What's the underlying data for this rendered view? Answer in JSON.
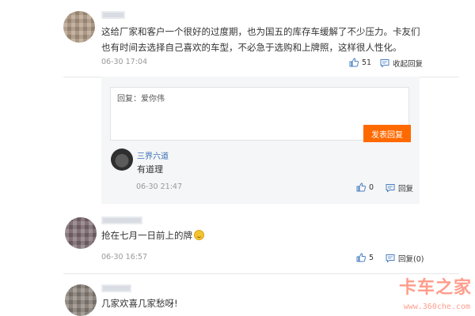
{
  "comments": [
    {
      "text": "这给厂家和客户一个很好的过度期，也为国五的库存车缓解了不少压力。卡友们也有时间去选择自己喜欢的车型，不必急于选购和上牌照，这样很人性化。",
      "time": "06-30 17:04",
      "likes": "51",
      "reply_label": "收起回复"
    },
    {
      "text": "抢在七月一日前上的牌",
      "time": "06-30 16:57",
      "likes": "5",
      "reply_label": "回复(0)"
    },
    {
      "text": "几家欢喜几家愁呀!"
    }
  ],
  "reply_form": {
    "placeholder": "回复：爱你伟",
    "submit_label": "发表回复"
  },
  "sub_reply": {
    "name": "三界六道",
    "text": "有道理",
    "time": "06-30 21:47",
    "likes": "0",
    "reply_label": "回复"
  },
  "watermark": {
    "brand": "卡车之家",
    "url": "www.360che.com"
  },
  "colors": {
    "accent": "#ff6a00",
    "link": "#3a6fb3",
    "muted": "#999999"
  },
  "icons": {
    "like": "thumbs-up-icon",
    "reply": "comment-icon"
  }
}
